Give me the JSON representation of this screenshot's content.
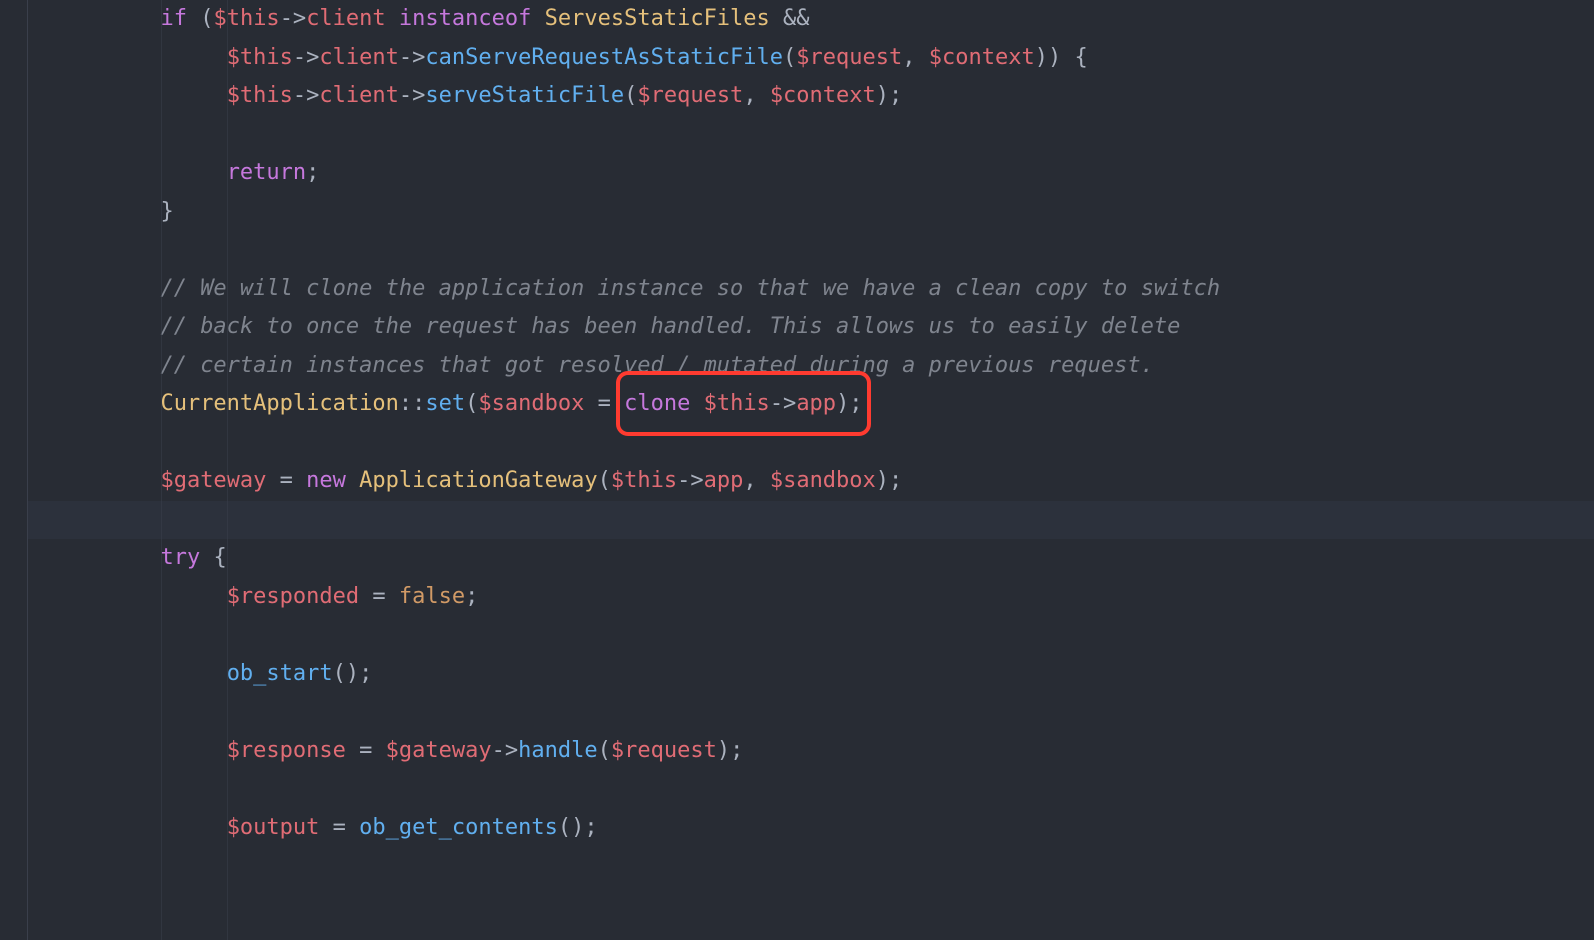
{
  "colors": {
    "bg": "#282c34",
    "fg": "#abb2bf",
    "keyword": "#c678dd",
    "variable": "#e06c75",
    "function": "#61afef",
    "class": "#e5c07b",
    "comment": "#7f848e",
    "number": "#d19a66",
    "highlight_line": "#2c313c",
    "annotation_box": "#ff3b30"
  },
  "highlight_line_index": 13,
  "annotation_box": {
    "around_text": "clone $this->app);",
    "line_index": 10
  },
  "lines": [
    {
      "indent": 2,
      "tokens": [
        {
          "t": "if ",
          "c": "kw"
        },
        {
          "t": "(",
          "c": "punct"
        },
        {
          "t": "$this",
          "c": "var"
        },
        {
          "t": "->",
          "c": "punct"
        },
        {
          "t": "client",
          "c": "prop"
        },
        {
          "t": " ",
          "c": "punct"
        },
        {
          "t": "instanceof",
          "c": "kw"
        },
        {
          "t": " ",
          "c": "punct"
        },
        {
          "t": "ServesStaticFiles",
          "c": "class"
        },
        {
          "t": " ",
          "c": "punct"
        },
        {
          "t": "&&",
          "c": "punct"
        }
      ]
    },
    {
      "indent": 3,
      "tokens": [
        {
          "t": "$this",
          "c": "var"
        },
        {
          "t": "->",
          "c": "punct"
        },
        {
          "t": "client",
          "c": "prop"
        },
        {
          "t": "->",
          "c": "punct"
        },
        {
          "t": "canServeRequestAsStaticFile",
          "c": "func"
        },
        {
          "t": "(",
          "c": "punct"
        },
        {
          "t": "$request",
          "c": "var"
        },
        {
          "t": ", ",
          "c": "punct"
        },
        {
          "t": "$context",
          "c": "var"
        },
        {
          "t": ")) {",
          "c": "punct"
        }
      ]
    },
    {
      "indent": 3,
      "tokens": [
        {
          "t": "$this",
          "c": "var"
        },
        {
          "t": "->",
          "c": "punct"
        },
        {
          "t": "client",
          "c": "prop"
        },
        {
          "t": "->",
          "c": "punct"
        },
        {
          "t": "serveStaticFile",
          "c": "func"
        },
        {
          "t": "(",
          "c": "punct"
        },
        {
          "t": "$request",
          "c": "var"
        },
        {
          "t": ", ",
          "c": "punct"
        },
        {
          "t": "$context",
          "c": "var"
        },
        {
          "t": ");",
          "c": "punct"
        }
      ]
    },
    {
      "indent": 3,
      "tokens": []
    },
    {
      "indent": 3,
      "tokens": [
        {
          "t": "return",
          "c": "kw"
        },
        {
          "t": ";",
          "c": "punct"
        }
      ]
    },
    {
      "indent": 2,
      "tokens": [
        {
          "t": "}",
          "c": "punct"
        }
      ]
    },
    {
      "indent": 2,
      "tokens": []
    },
    {
      "indent": 2,
      "tokens": [
        {
          "t": "// We will clone the application instance so that we have a clean copy to switch",
          "c": "comment"
        }
      ]
    },
    {
      "indent": 2,
      "tokens": [
        {
          "t": "// back to once the request has been handled. This allows us to easily delete",
          "c": "comment"
        }
      ]
    },
    {
      "indent": 2,
      "tokens": [
        {
          "t": "// certain instances that got resolved / mutated during a previous request.",
          "c": "comment"
        }
      ]
    },
    {
      "indent": 2,
      "tokens": [
        {
          "t": "CurrentApplication",
          "c": "class"
        },
        {
          "t": "::",
          "c": "punct"
        },
        {
          "t": "set",
          "c": "func"
        },
        {
          "t": "(",
          "c": "punct"
        },
        {
          "t": "$sandbox",
          "c": "var"
        },
        {
          "t": " = ",
          "c": "punct"
        },
        {
          "t": "clone",
          "c": "kw"
        },
        {
          "t": " ",
          "c": "punct"
        },
        {
          "t": "$this",
          "c": "var"
        },
        {
          "t": "->",
          "c": "punct"
        },
        {
          "t": "app",
          "c": "prop"
        },
        {
          "t": ");",
          "c": "punct"
        }
      ]
    },
    {
      "indent": 2,
      "tokens": []
    },
    {
      "indent": 2,
      "tokens": [
        {
          "t": "$gateway",
          "c": "var"
        },
        {
          "t": " = ",
          "c": "punct"
        },
        {
          "t": "new",
          "c": "kw"
        },
        {
          "t": " ",
          "c": "punct"
        },
        {
          "t": "ApplicationGateway",
          "c": "class"
        },
        {
          "t": "(",
          "c": "punct"
        },
        {
          "t": "$this",
          "c": "var"
        },
        {
          "t": "->",
          "c": "punct"
        },
        {
          "t": "app",
          "c": "prop"
        },
        {
          "t": ", ",
          "c": "punct"
        },
        {
          "t": "$sandbox",
          "c": "var"
        },
        {
          "t": ");",
          "c": "punct"
        }
      ]
    },
    {
      "indent": 2,
      "tokens": []
    },
    {
      "indent": 2,
      "tokens": [
        {
          "t": "try",
          "c": "kw"
        },
        {
          "t": " {",
          "c": "punct"
        }
      ]
    },
    {
      "indent": 3,
      "tokens": [
        {
          "t": "$responded",
          "c": "var"
        },
        {
          "t": " = ",
          "c": "punct"
        },
        {
          "t": "false",
          "c": "bool"
        },
        {
          "t": ";",
          "c": "punct"
        }
      ]
    },
    {
      "indent": 3,
      "tokens": []
    },
    {
      "indent": 3,
      "tokens": [
        {
          "t": "ob_start",
          "c": "func"
        },
        {
          "t": "();",
          "c": "punct"
        }
      ]
    },
    {
      "indent": 3,
      "tokens": []
    },
    {
      "indent": 3,
      "tokens": [
        {
          "t": "$response",
          "c": "var"
        },
        {
          "t": " = ",
          "c": "punct"
        },
        {
          "t": "$gateway",
          "c": "var"
        },
        {
          "t": "->",
          "c": "punct"
        },
        {
          "t": "handle",
          "c": "func"
        },
        {
          "t": "(",
          "c": "punct"
        },
        {
          "t": "$request",
          "c": "var"
        },
        {
          "t": ");",
          "c": "punct"
        }
      ]
    },
    {
      "indent": 3,
      "tokens": []
    },
    {
      "indent": 3,
      "tokens": [
        {
          "t": "$output",
          "c": "var"
        },
        {
          "t": " = ",
          "c": "punct"
        },
        {
          "t": "ob_get_contents",
          "c": "func"
        },
        {
          "t": "();",
          "c": "punct"
        }
      ]
    }
  ]
}
